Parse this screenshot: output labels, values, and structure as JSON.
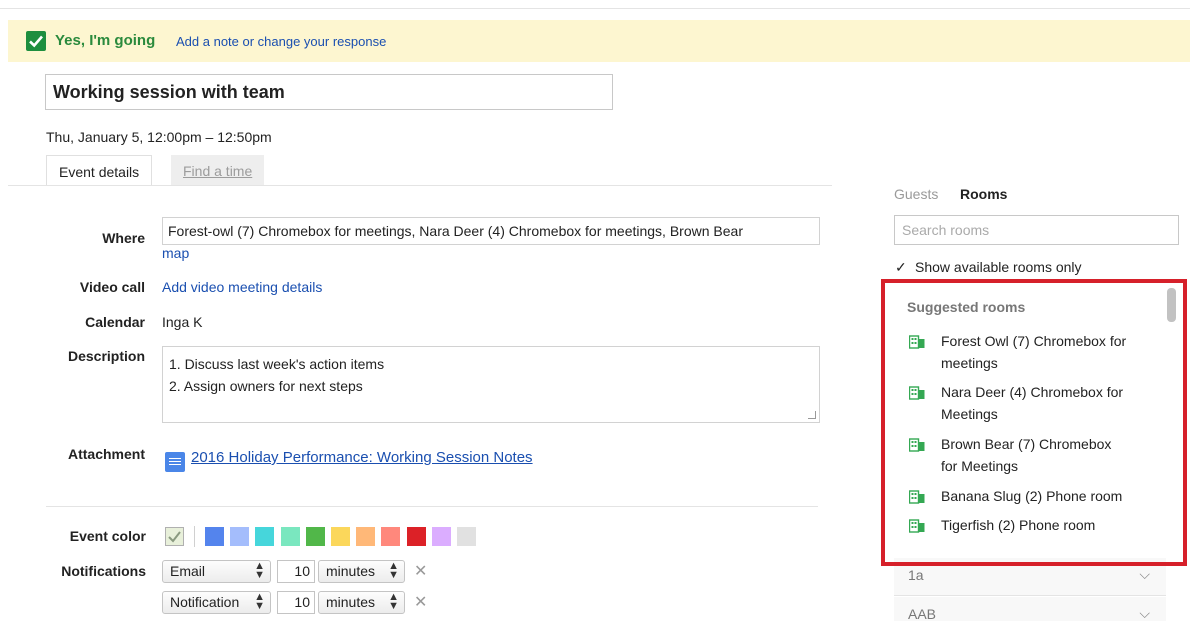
{
  "rsvp": {
    "status": "Yes, I'm going",
    "action_link": "Add a note or change your response"
  },
  "event": {
    "title": "Working session with team",
    "datetime": "Thu, January 5, 12:00pm – 12:50pm"
  },
  "tabs": [
    {
      "label": "Event details",
      "active": true
    },
    {
      "label": "Find a time",
      "active": false
    }
  ],
  "details": {
    "where_label": "Where",
    "where_value": "Forest-owl (7) Chromebox for meetings, Nara Deer (4) Chromebox for meetings, Brown Bear",
    "map_link": "map",
    "video_label": "Video call",
    "video_link": "Add video meeting details",
    "calendar_label": "Calendar",
    "calendar_value": "Inga K",
    "description_label": "Description",
    "description_lines": [
      "1. Discuss last week's action items",
      "2. Assign owners for next steps"
    ],
    "attachment_label": "Attachment",
    "attachment_link": "2016 Holiday Performance: Working Session Notes",
    "event_color_label": "Event color",
    "event_colors": [
      "#e8f0da",
      "#5484ed",
      "#a4bdfc",
      "#46d6db",
      "#7ae7bf",
      "#51b749",
      "#fbd75b",
      "#ffb878",
      "#ff887c",
      "#dc2127",
      "#dbadff",
      "#e1e1e1"
    ],
    "notifications_label": "Notifications",
    "notifications": [
      {
        "method": "Email",
        "amount": "10",
        "unit": "minutes"
      },
      {
        "method": "Notification",
        "amount": "10",
        "unit": "minutes"
      }
    ]
  },
  "sidebar": {
    "tab_guests": "Guests",
    "tab_rooms": "Rooms",
    "search_placeholder": "Search rooms",
    "available_only_label": "Show available rooms only",
    "available_only_checked": true,
    "suggested_title": "Suggested rooms",
    "rooms": [
      {
        "line1": "Forest Owl (7) Chromebox for",
        "line2": "meetings"
      },
      {
        "line1": "Nara Deer (4) Chromebox for",
        "line2": "Meetings"
      },
      {
        "line1": "Brown Bear (7) Chromebox",
        "line2": "for Meetings"
      },
      {
        "line1": "Banana Slug (2) Phone room",
        "line2": ""
      },
      {
        "line1": "Tigerfish (2) Phone room",
        "line2": ""
      }
    ],
    "groups": [
      "1a",
      "AAB"
    ]
  },
  "colors": {
    "highlight_frame": "#d6202a",
    "rsvp_background": "#fdf6d0",
    "accent_green": "#2a8a3c",
    "link_blue": "#1a4fb0"
  }
}
